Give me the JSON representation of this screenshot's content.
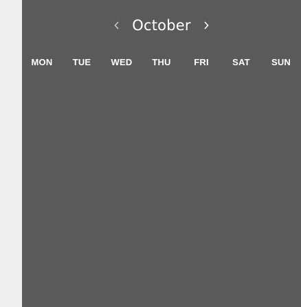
{
  "calendar": {
    "month_label": "October",
    "prev_icon": "chevron-left-icon",
    "next_icon": "chevron-right-icon",
    "weekdays": [
      "MON",
      "TUE",
      "WED",
      "THU",
      "FRI",
      "SAT",
      "SUN"
    ]
  },
  "colors": {
    "page_background": "#efefef",
    "panel_background": "#5a5a5a",
    "text": "#ffffff",
    "prev_arrow": "#c8c8c8",
    "next_arrow": "#ffffff"
  }
}
